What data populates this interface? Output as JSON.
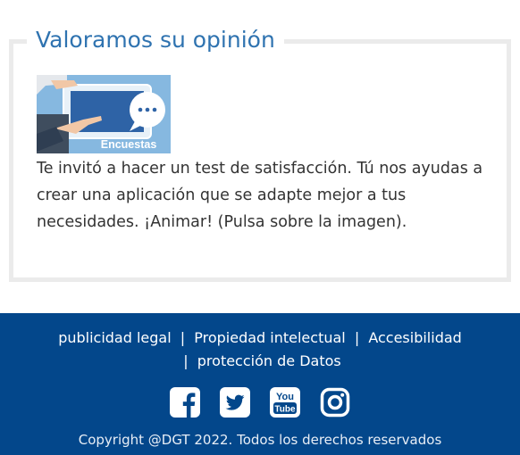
{
  "feedback": {
    "title": "Valoramos su opinión",
    "image_label": "Encuestas",
    "description": "Te invitó a hacer un test de satisfacción. Tú nos ayudas a crear una aplicación que se adapte mejor a tus necesidades. ¡Animar! (Pulsa sobre la imagen)."
  },
  "footer": {
    "links": [
      "publicidad legal",
      "Propiedad intelectual",
      "Accesibilidad",
      "protección de Datos"
    ],
    "separator": "|",
    "social_icons": [
      "facebook-icon",
      "twitter-icon",
      "youtube-icon",
      "instagram-icon"
    ],
    "youtube_text": [
      "You",
      "Tube"
    ],
    "copyright": "Copyright @DGT 2022. Todos los derechos reservados"
  },
  "colors": {
    "accent": "#2f73b0",
    "footer_bg": "#03478b",
    "panel_border": "#ebebeb",
    "text": "#333333"
  }
}
